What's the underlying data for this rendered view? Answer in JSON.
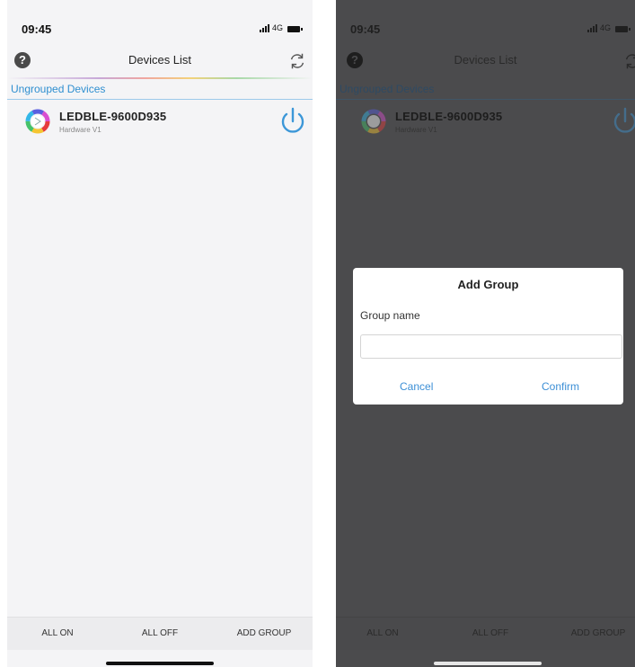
{
  "left_screen": {
    "status_bar": {
      "time": "09:45",
      "network": "4G"
    },
    "nav": {
      "title": "Devices List",
      "help_icon": "question-circle-icon",
      "refresh_icon": "refresh-icon"
    },
    "group_header": "Ungrouped Devices",
    "devices": [
      {
        "name": "LEDBLE-9600D935",
        "hardware": "Hardware V1",
        "icon": "color-wheel-icon",
        "power_icon": "power-icon"
      }
    ],
    "bottom_bar": {
      "all_on": "ALL ON",
      "all_off": "ALL OFF",
      "add_group": "ADD GROUP"
    }
  },
  "right_screen": {
    "status_bar": {
      "time": "09:45",
      "network": "4G"
    },
    "nav": {
      "title": "Devices List"
    },
    "group_header": "Ungrouped Devices",
    "devices": [
      {
        "name": "LEDBLE-9600D935",
        "hardware": "Hardware V1"
      }
    ],
    "bottom_bar": {
      "all_on": "ALL ON",
      "all_off": "ALL OFF",
      "add_group": "ADD GROUP"
    },
    "dialog": {
      "title": "Add Group",
      "field_label": "Group name",
      "input_value": "",
      "cancel_label": "Cancel",
      "confirm_label": "Confirm"
    }
  },
  "colors": {
    "accent_blue": "#2f8fd0",
    "dialog_button": "#3c8fd6",
    "overlay": "#4b4b4d"
  }
}
